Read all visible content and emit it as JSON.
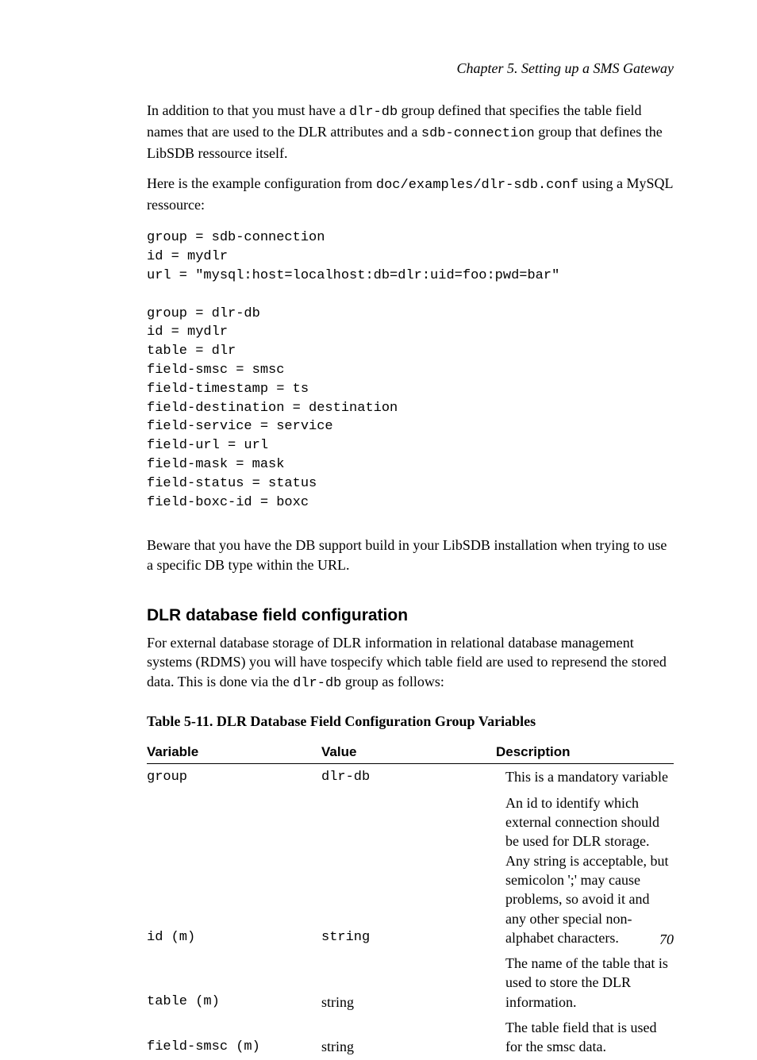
{
  "chapter_header": "Chapter 5. Setting up a SMS Gateway",
  "intro": {
    "p1_a": "In addition to that you must have a ",
    "p1_code1": "dlr-db",
    "p1_b": " group defined that specifies the table field names that are used to the DLR attributes and a ",
    "p1_code2": "sdb-connection",
    "p1_c": " group that defines the LibSDB ressource itself.",
    "p2_a": "Here is the example configuration from ",
    "p2_code": "doc/examples/dlr-sdb.conf",
    "p2_b": " using a MySQL ressource:"
  },
  "config_block": "group = sdb-connection\nid = mydlr\nurl = \"mysql:host=localhost:db=dlr:uid=foo:pwd=bar\"\n\ngroup = dlr-db\nid = mydlr\ntable = dlr\nfield-smsc = smsc\nfield-timestamp = ts\nfield-destination = destination\nfield-service = service\nfield-url = url\nfield-mask = mask\nfield-status = status\nfield-boxc-id = boxc",
  "beware_p": "Beware that you have the DB support build in your LibSDB installation when trying to use a specific DB type within the URL.",
  "section_heading": "DLR database field configuration",
  "section_p_a": "For external database storage of DLR information in relational database management systems (RDMS) you will have tospecify which table field are used to represend the stored data. This is done via the ",
  "section_p_code": "dlr-db",
  "section_p_b": " group as follows:",
  "table_caption": "Table 5-11. DLR Database Field Configuration Group Variables",
  "table": {
    "headers": {
      "variable": "Variable",
      "value": "Value",
      "description": "Description"
    },
    "rows": [
      {
        "variable": "group",
        "value": "dlr-db",
        "value_mono": true,
        "description": "This is a mandatory variable"
      },
      {
        "variable": "id (m)",
        "value": "string",
        "value_mono": true,
        "description": "An id to identify which external connection should be used for DLR storage. Any string is acceptable, but semicolon ';' may cause problems, so avoid it and any other special non-alphabet characters."
      },
      {
        "variable": "table (m)",
        "value": "string",
        "value_mono": false,
        "description": "The name of the table that is used to store the DLR information."
      },
      {
        "variable": "field-smsc (m)",
        "value": "string",
        "value_mono": false,
        "description": "The table field that is used for the smsc data."
      }
    ]
  },
  "page_number": "70"
}
